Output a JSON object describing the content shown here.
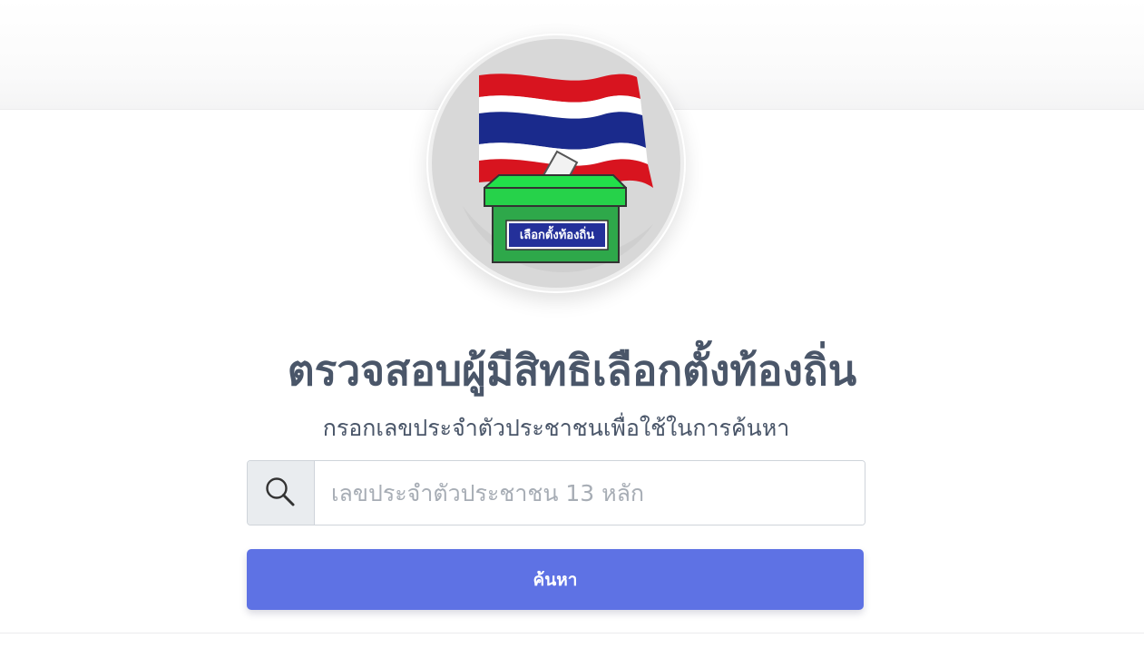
{
  "logo": {
    "ballot_box_label": "เลือกตั้งท้องถิ่น"
  },
  "header": {
    "title": "ตรวจสอบผู้มีสิทธิเลือกตั้งท้องถิ่น",
    "subtitle": "กรอกเลขประจำตัวประชาชนเพื่อใช้ในการค้นหา"
  },
  "search": {
    "icon": "search-icon",
    "placeholder": "เลขประจำตัวประชาชน 13 หลัก",
    "value": "",
    "button_label": "ค้นหา"
  },
  "colors": {
    "title_text": "#4a5669",
    "button_bg": "#5e72e4",
    "ballot_box": "#2ea84a",
    "ballot_lid": "#22e04a",
    "label_bg": "#24309a",
    "flag_red": "#d8141f",
    "flag_white": "#ffffff",
    "flag_blue": "#1a2a8c"
  }
}
